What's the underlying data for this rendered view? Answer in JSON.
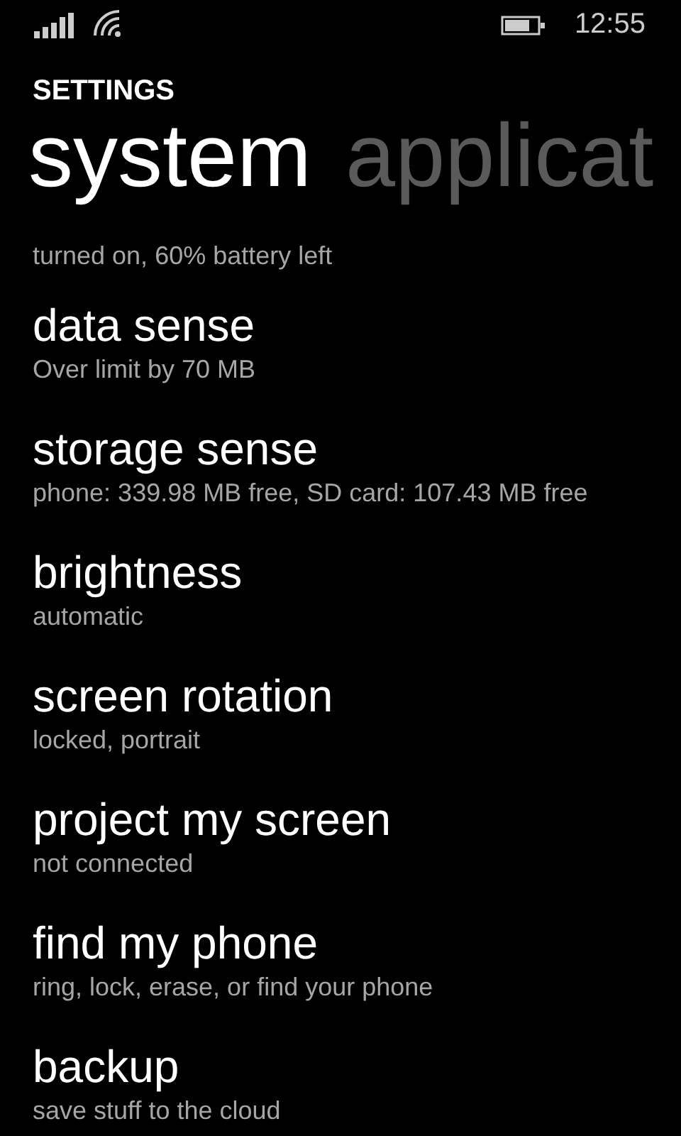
{
  "status_bar": {
    "time": "12:55"
  },
  "header": {
    "title": "SETTINGS"
  },
  "pivot": [
    {
      "label": "system",
      "selected": true
    },
    {
      "label": "applicat",
      "selected": false
    }
  ],
  "items": [
    {
      "subtitle": "turned on, 60% battery left"
    },
    {
      "title": "data sense",
      "subtitle": "Over limit by 70 MB"
    },
    {
      "title": "storage sense",
      "subtitle": "phone: 339.98 MB free, SD card: 107.43 MB free"
    },
    {
      "title": "brightness",
      "subtitle": "automatic"
    },
    {
      "title": "screen rotation",
      "subtitle": "locked, portrait"
    },
    {
      "title": "project my screen",
      "subtitle": "not connected"
    },
    {
      "title": "find my phone",
      "subtitle": "ring, lock, erase, or find your phone"
    },
    {
      "title": "backup",
      "subtitle": "save stuff to the cloud"
    }
  ]
}
